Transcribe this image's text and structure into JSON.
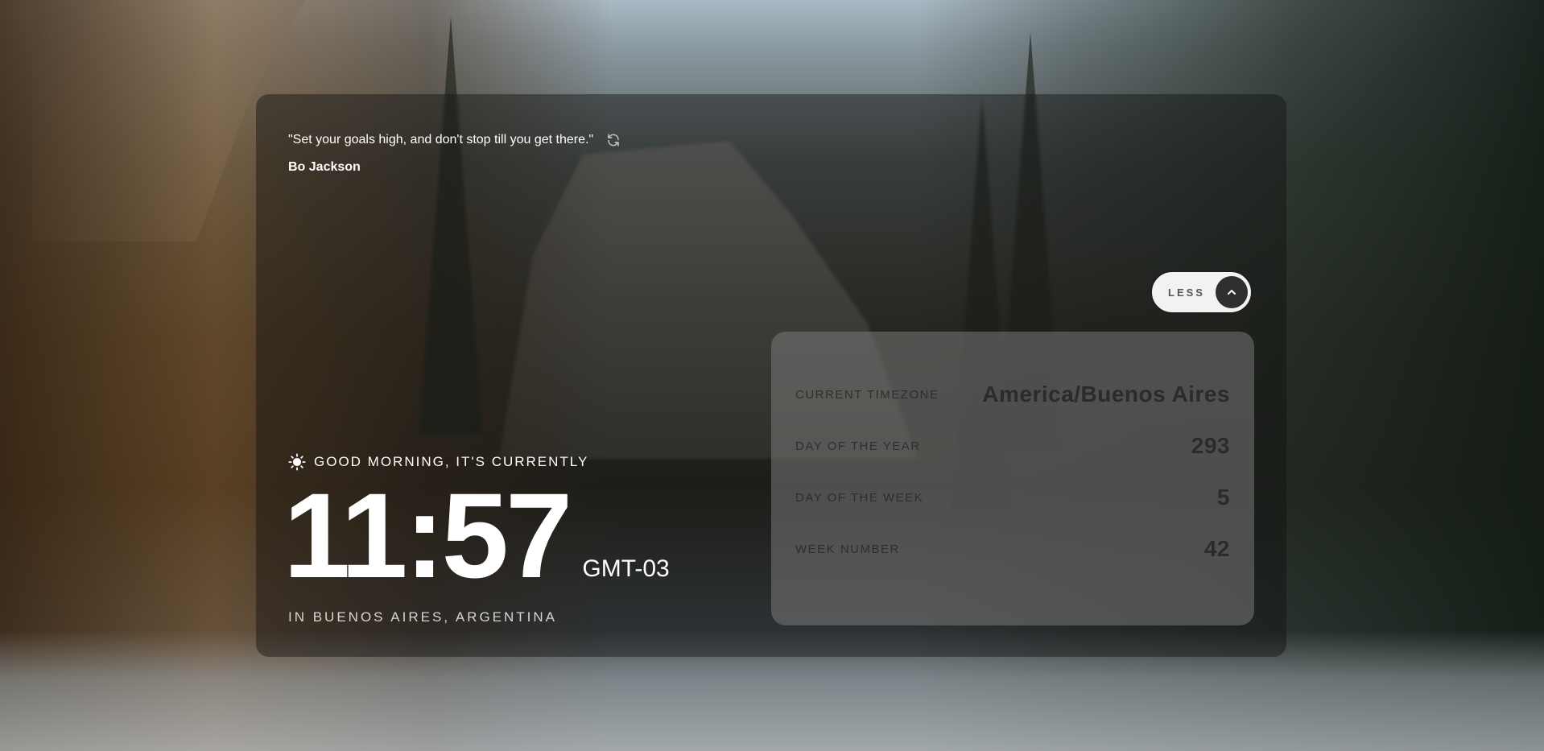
{
  "quote": {
    "text": "\"Set your goals high, and don't stop till you get there.\"",
    "author": "Bo Jackson",
    "refresh_icon": "refresh-icon"
  },
  "greeting": {
    "icon": "sun-icon",
    "text": "GOOD MORNING, IT'S CURRENTLY"
  },
  "clock": {
    "time": "11:57",
    "timezone_abbr": "GMT-03",
    "location": "IN BUENOS AIRES, ARGENTINA"
  },
  "toggle": {
    "label": "LESS",
    "icon": "chevron-up-icon"
  },
  "details": {
    "rows": [
      {
        "label": "CURRENT TIMEZONE",
        "value": "America/Buenos Aires"
      },
      {
        "label": "DAY OF THE YEAR",
        "value": "293"
      },
      {
        "label": "DAY OF THE WEEK",
        "value": "5"
      },
      {
        "label": "WEEK NUMBER",
        "value": "42"
      }
    ]
  },
  "colors": {
    "panel_bg": "#121212",
    "details_bg": "#787878",
    "text_light": "#ffffff",
    "text_dark": "#2b2b2b",
    "button_bg": "#f2f2f2",
    "button_icon_bg": "#2f2f2f"
  }
}
